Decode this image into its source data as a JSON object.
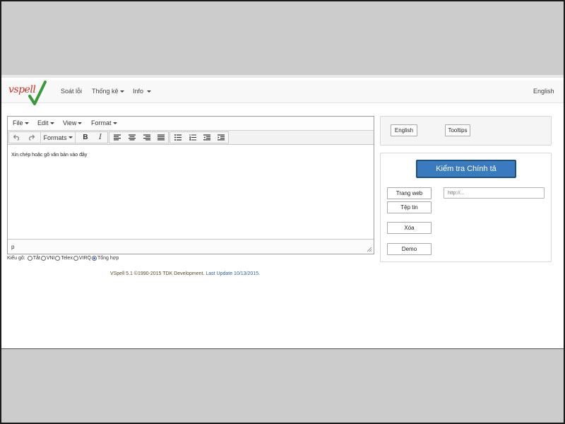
{
  "logo": {
    "text": "vspell"
  },
  "nav": {
    "items": [
      {
        "label": "Soát lỗi"
      },
      {
        "label": "Thống kê"
      },
      {
        "label": "Info"
      }
    ],
    "language": "English"
  },
  "editor": {
    "menu": [
      "File",
      "Edit",
      "View",
      "Format"
    ],
    "formats_label": "Formats",
    "bold_label": "B",
    "italic_label": "I",
    "content": "Xin chép hoặc gõ văn bản vào đây",
    "status_path": "p"
  },
  "input_method": {
    "label": "Kiểu gõ:",
    "options": [
      "Tắt",
      "VNI",
      "Telex",
      "VIRQ",
      "Tổng hợp"
    ],
    "selected": "Tổng hợp"
  },
  "footer": {
    "text": "VSpell 5.1 ©1990-2015 TDK Development.",
    "update": "Last Update 10/13/2015."
  },
  "panel1": {
    "english_button": "English",
    "tooltips_button": "Tooltips"
  },
  "panel2": {
    "check_button": "Kiểm tra Chính tả",
    "webpage_button": "Trang web",
    "file_button": "Tệp tin",
    "delete_button": "Xóa",
    "demo_button": "Demo",
    "url_placeholder": "http://..."
  },
  "colors": {
    "primary": "#3a7bbf",
    "logo_red": "#c9302c",
    "logo_check": "#3a9a3a"
  }
}
